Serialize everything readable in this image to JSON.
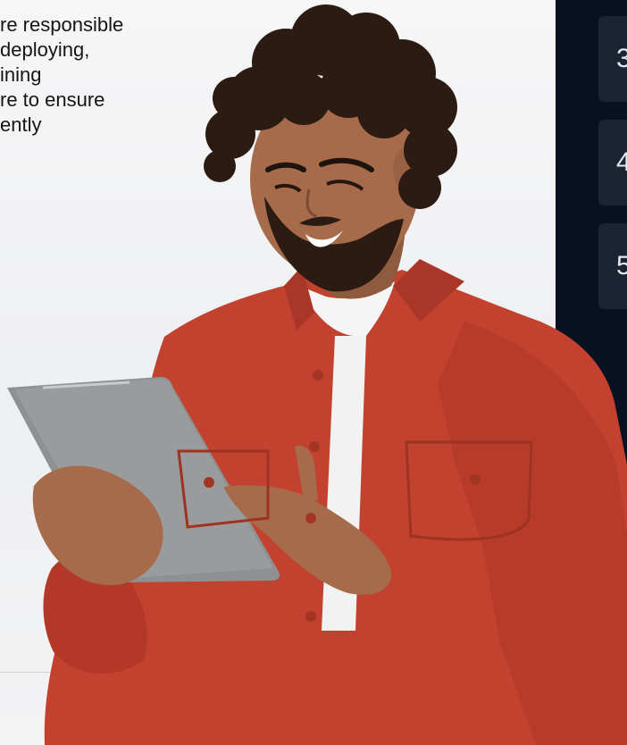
{
  "intro": {
    "lines": [
      "re responsible",
      " deploying,",
      "ining",
      "re to ensure",
      "ently"
    ]
  },
  "steps": {
    "items": [
      "3",
      "4",
      "5"
    ]
  },
  "photo": {
    "subject": "",
    "colors": {
      "shirt": "#c2412f",
      "tablet": "#8f9092",
      "skin": "#a66b4b",
      "hair": "#2b1b13",
      "navy": "#071120"
    }
  }
}
